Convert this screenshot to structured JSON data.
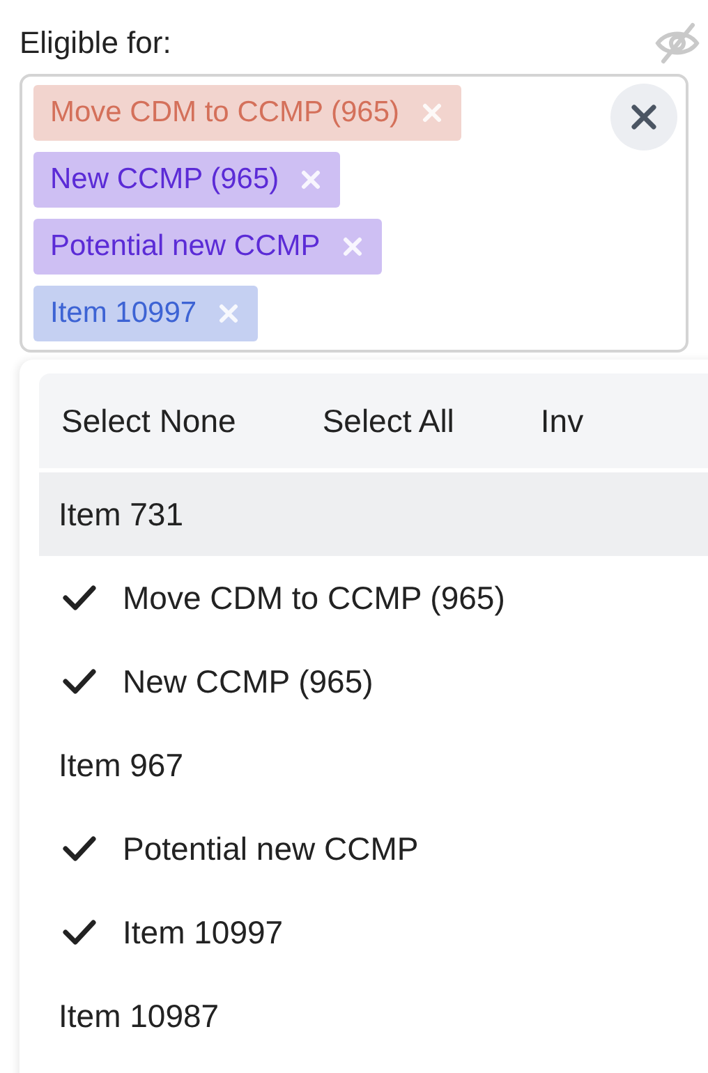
{
  "field": {
    "label": "Eligible for:",
    "tags": [
      {
        "label": "Move CDM to CCMP (965)",
        "color": "#d4705a"
      },
      {
        "label": "New CCMP (965)",
        "color": "#5b2bd6"
      },
      {
        "label": "Potential new CCMP",
        "color": "#5b2bd6"
      },
      {
        "label": "Item 10997",
        "color": "#3d63d4"
      }
    ]
  },
  "dropdown": {
    "actions": [
      "Select None",
      "Select All",
      "Inv"
    ],
    "options": [
      {
        "label": "Item 731",
        "checked": false,
        "highlighted": true
      },
      {
        "label": "Move CDM to CCMP (965)",
        "checked": true,
        "highlighted": false
      },
      {
        "label": "New CCMP (965)",
        "checked": true,
        "highlighted": false
      },
      {
        "label": "Item 967",
        "checked": false,
        "highlighted": false
      },
      {
        "label": "Potential new CCMP",
        "checked": true,
        "highlighted": false
      },
      {
        "label": "Item 10997",
        "checked": true,
        "highlighted": false
      },
      {
        "label": "Item 10987",
        "checked": false,
        "highlighted": false
      }
    ]
  }
}
